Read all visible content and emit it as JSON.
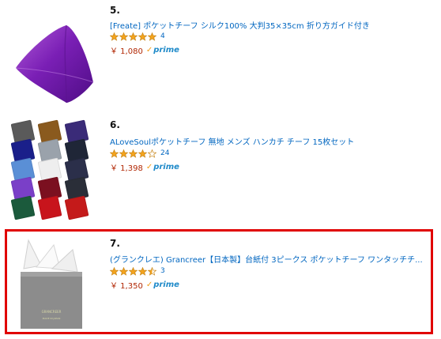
{
  "products": [
    {
      "rank": "5.",
      "title": "[Freate] ポケットチーフ シルク100% 大判35×35cm 折り方ガイド付き",
      "rating": 5,
      "review_count": "4",
      "price": "￥ 1,080",
      "prime": "prime",
      "image_icon": "purple-silk-pocket-square"
    },
    {
      "rank": "6.",
      "title": "ALoveSoulポケットチーフ 無地 メンズ ハンカチ チーフ 15枚セット",
      "rating": 4,
      "review_count": "24",
      "price": "￥ 1,398",
      "prime": "prime",
      "image_icon": "pocket-square-set-grid"
    },
    {
      "rank": "7.",
      "title": "(グランクレエ) Grancreer【日本製】台紙付 3ピークス ポケットチーフ ワンタッチチ...",
      "rating": 4.5,
      "review_count": "3",
      "price": "￥ 1,350",
      "prime": "prime",
      "image_icon": "white-three-peak-pocket-square"
    }
  ],
  "colors": {
    "link": "#0066c0",
    "price": "#b12704",
    "star": "#f4a41d",
    "prime": "#1f8ac9",
    "highlight": "#e00000"
  },
  "grid_swatches": [
    "#5a5a5a",
    "#8a5a1e",
    "#3a2b78",
    "#1a1f8a",
    "#9aa2ab",
    "#1f2637",
    "#5a8fd6",
    "#eeeeee",
    "#2b2f4a",
    "#7a3fc8",
    "#7b1020",
    "#2a2e38",
    "#1b5a3c",
    "#c8141c",
    "#c41a1a"
  ]
}
